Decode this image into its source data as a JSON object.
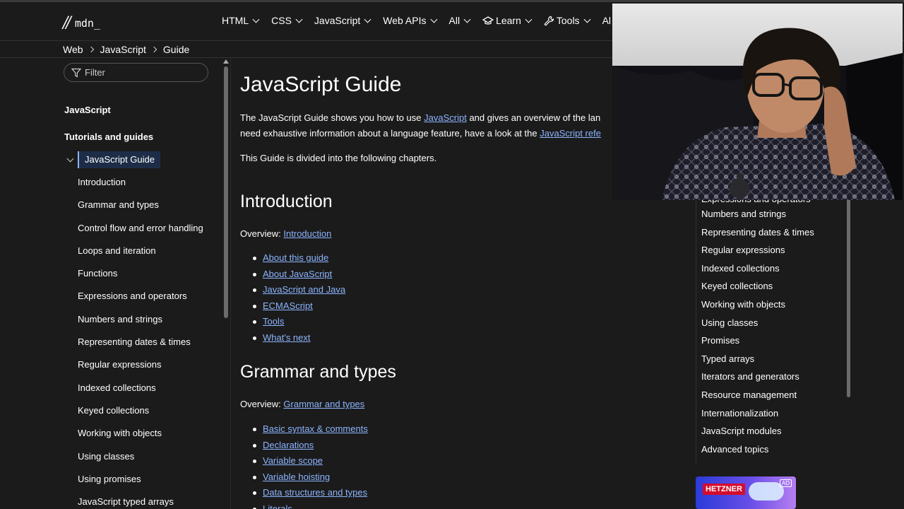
{
  "nav": {
    "logo_text": "mdn_",
    "items": [
      {
        "label": "HTML",
        "icon": "",
        "has_chevron": true
      },
      {
        "label": "CSS",
        "icon": "",
        "has_chevron": true
      },
      {
        "label": "JavaScript",
        "icon": "",
        "has_chevron": true
      },
      {
        "label": "Web APIs",
        "icon": "",
        "has_chevron": true
      },
      {
        "label": "All",
        "icon": "",
        "has_chevron": true
      },
      {
        "label": "Learn",
        "icon": "graduation-cap-icon",
        "has_chevron": true
      },
      {
        "label": "Tools",
        "icon": "wrench-icon",
        "has_chevron": true
      },
      {
        "label": "Al",
        "icon": "",
        "has_chevron": false
      }
    ]
  },
  "breadcrumb": [
    "Web",
    "JavaScript",
    "Guide"
  ],
  "sidebar": {
    "filter_placeholder": "Filter",
    "section_heading": "JavaScript",
    "group_heading": "Tutorials and guides",
    "active_item": "JavaScript Guide",
    "items": [
      "Introduction",
      "Grammar and types",
      "Control flow and error handling",
      "Loops and iteration",
      "Functions",
      "Expressions and operators",
      "Numbers and strings",
      "Representing dates & times",
      "Regular expressions",
      "Indexed collections",
      "Keyed collections",
      "Working with objects",
      "Using classes",
      "Using promises",
      "JavaScript typed arrays"
    ]
  },
  "main": {
    "title": "JavaScript Guide",
    "intro_1_a": "The JavaScript Guide shows you how to use ",
    "intro_1_link": "JavaScript",
    "intro_1_b": " and gives an overview of the lan",
    "intro_2_a": "need exhaustive information about a language feature, have a look at the ",
    "intro_2_link": "JavaScript refe",
    "intro_3": "This Guide is divided into the following chapters.",
    "sections": [
      {
        "heading": "Introduction",
        "overview_label": "Overview: ",
        "overview_link": "Introduction",
        "links": [
          "About this guide",
          "About JavaScript",
          "JavaScript and Java",
          "ECMAScript",
          "Tools",
          "What's next"
        ]
      },
      {
        "heading": "Grammar and types",
        "overview_label": "Overview: ",
        "overview_link": "Grammar and types",
        "links": [
          "Basic syntax & comments",
          "Declarations",
          "Variable scope",
          "Variable hoisting",
          "Data structures and types",
          "Literals"
        ]
      }
    ]
  },
  "toc": {
    "partial_item": "Expressions and operators",
    "items": [
      "Numbers and strings",
      "Representing dates & times",
      "Regular expressions",
      "Indexed collections",
      "Keyed collections",
      "Working with objects",
      "Using classes",
      "Promises",
      "Typed arrays",
      "Iterators and generators",
      "Resource management",
      "Internationalization",
      "JavaScript modules",
      "Advanced topics"
    ]
  },
  "ad": {
    "brand": "HETZNER",
    "badge": "AD"
  },
  "colors": {
    "background": "#1b1b1b",
    "link": "#8cb4ff",
    "active_bg": "#1d2d48",
    "ad_brand": "#d50c2d"
  }
}
